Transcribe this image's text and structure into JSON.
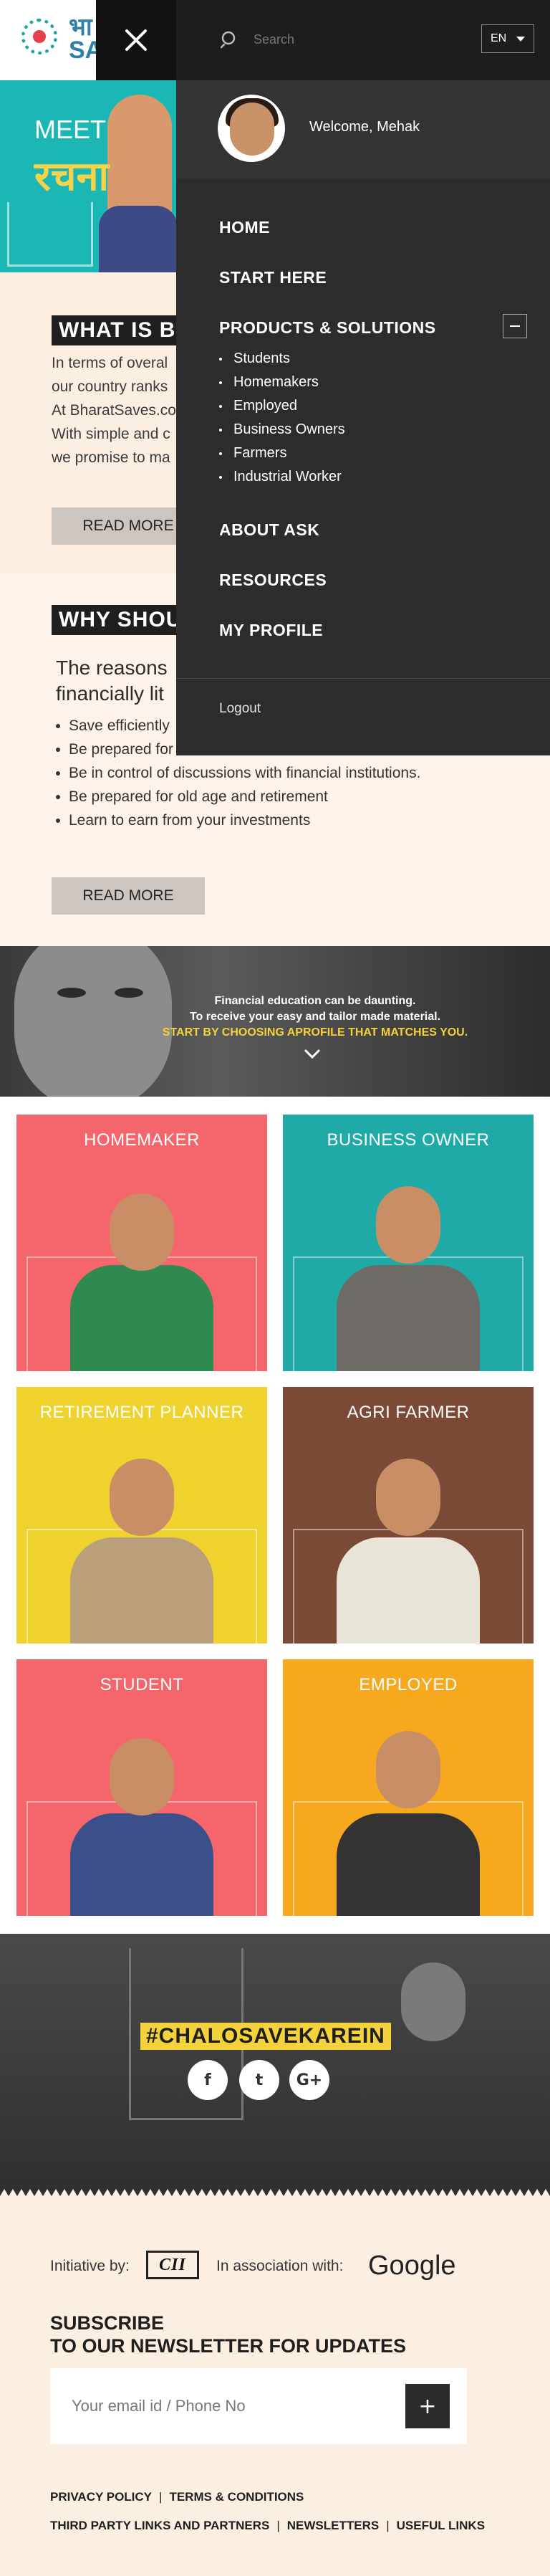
{
  "brand": {
    "logo_text": "भा\nSA"
  },
  "hero": {
    "meet": "MEET",
    "title": "रचना"
  },
  "what_section": {
    "heading": "WHAT IS BI",
    "paragraph_lines": [
      "In terms of overal",
      "our country ranks",
      "At BharatSaves.co",
      "With simple and c",
      "we promise to ma"
    ],
    "read_more": "READ MORE"
  },
  "why_section": {
    "heading": "WHY SHOU",
    "lead_lines": [
      "The reasons",
      "financially lit"
    ],
    "bullets": [
      "Save efficiently",
      "Be prepared for unforeseen circumstances.",
      "Be in control of discussions with financial institutions.",
      "Be prepared for old age and retirement",
      "Learn to earn from your investments"
    ],
    "read_more": "READ MORE"
  },
  "banner": {
    "line1": "Financial education can be daunting.",
    "line2": "To receive your easy and tailor made material.",
    "line3": "START BY CHOOSING  APROFILE THAT MATCHES YOU."
  },
  "profiles": [
    {
      "label": "HOMEMAKER",
      "color": "#f4666b",
      "body": "#2f8a4f"
    },
    {
      "label": "BUSINESS OWNER",
      "color": "#20aaa7",
      "body": "#6e6a66"
    },
    {
      "label": "RETIREMENT PLANNER",
      "color": "#f0d22e",
      "body": "#b9a07a"
    },
    {
      "label": "AGRI FARMER",
      "color": "#7a4a36",
      "body": "#e9e4d8"
    },
    {
      "label": "STUDENT",
      "color": "#f4666b",
      "body": "#3b4f8a"
    },
    {
      "label": "EMPLOYED",
      "color": "#f6a91f",
      "body": "#333333"
    }
  ],
  "hashtag": {
    "text": "#CHALOSAVEKAREIN",
    "social": [
      {
        "name": "facebook-icon",
        "glyph": "f"
      },
      {
        "name": "twitter-icon",
        "glyph": "t"
      },
      {
        "name": "google-plus-icon",
        "glyph": "G+"
      }
    ]
  },
  "footer": {
    "initiative_label": "Initiative by:",
    "cii_logo": "CII",
    "association_label": "In association with:",
    "google_logo": "Google",
    "subscribe_line1": "SUBSCRIBE",
    "subscribe_line2": "TO OUR NEWSLETTER FOR UPDATES",
    "newsletter_placeholder": "Your email id / Phone No",
    "newsletter_submit": "+",
    "links_row1": [
      "PRIVACY POLICY",
      "TERMS & CONDITIONS"
    ],
    "links_row2": [
      "THIRD PARTY LINKS AND PARTNERS",
      "NEWSLETTERS",
      "USEFUL LINKS"
    ],
    "link_separator": "|"
  },
  "menu": {
    "search_placeholder": "Search",
    "language": "EN",
    "welcome": "Welcome, Mehak",
    "items": [
      "HOME",
      "START HERE",
      "PRODUCTS & SOLUTIONS",
      "ABOUT ASK",
      "RESOURCES",
      "MY PROFILE"
    ],
    "products_sub": [
      "Students",
      "Homemakers",
      "Employed",
      "Business Owners",
      "Farmers",
      "Industrial Worker"
    ],
    "logout": "Logout"
  },
  "colors": {
    "menu_bg": "#2c2c2c",
    "accent_yellow": "#f3d23c",
    "page_bg": "#fdeee2",
    "teal": "#1bb7b4"
  }
}
